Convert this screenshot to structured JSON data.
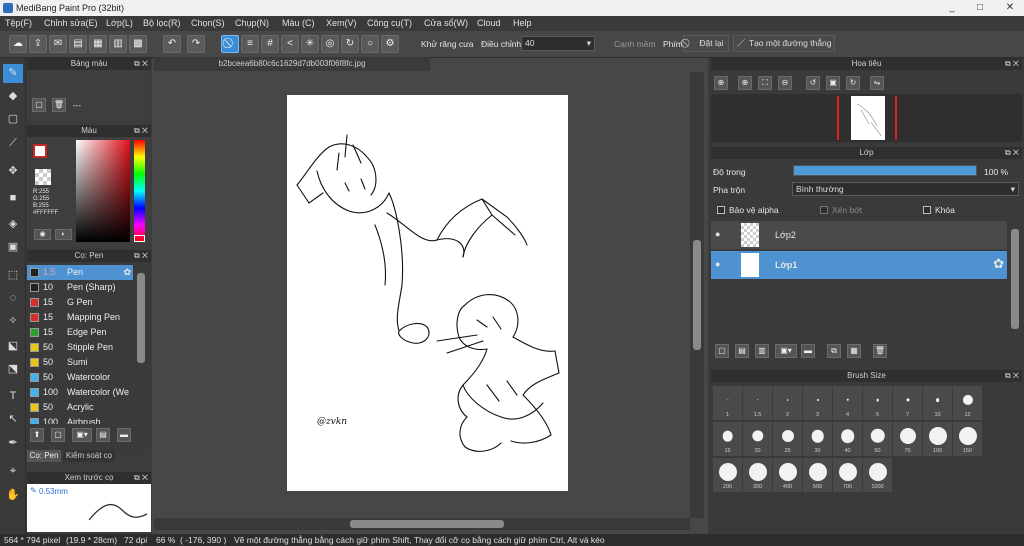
{
  "window": {
    "title": "MediBang Paint Pro (32bit)",
    "minimize": "_",
    "maximize": "□",
    "close": "✕"
  },
  "menu": [
    "Tệp(F)",
    "Chỉnh sửa(E)",
    "Lớp(L)",
    "Bộ lọc(R)",
    "Chọn(S)",
    "Chụp(N)",
    "Màu (C)",
    "Xem(V)",
    "Công cụ(T)",
    "Cửa sổ(W)",
    "Cloud",
    "Help"
  ],
  "toolbar": {
    "antialias_label": "Khử răng cưa",
    "adjust_label": "Điều chỉnh",
    "adjust_value": "40",
    "smooth_label": "Cạnh mềm",
    "key_label": "Phím",
    "reset_label": "Đặt lại",
    "straight_line_label": "Tạo một đường thẳng"
  },
  "palette_panel": {
    "title": "Bảng màu",
    "empty_label": "---"
  },
  "color_panel": {
    "title": "Màu",
    "r": "R:255",
    "g": "G:255",
    "b": "B:255",
    "hex": "#FFFFFF"
  },
  "brush_panel": {
    "title": "Cọ: Pen",
    "brushes": [
      {
        "size": "1.5",
        "name": "Pen",
        "color": "#222222"
      },
      {
        "size": "10",
        "name": "Pen (Sharp)",
        "color": "#222222"
      },
      {
        "size": "15",
        "name": "G Pen",
        "color": "#d32f2f"
      },
      {
        "size": "15",
        "name": "Mapping Pen",
        "color": "#d32f2f"
      },
      {
        "size": "15",
        "name": "Edge Pen",
        "color": "#2e9e2e"
      },
      {
        "size": "50",
        "name": "Stipple Pen",
        "color": "#e6c619"
      },
      {
        "size": "50",
        "name": "Sumi",
        "color": "#e6c619"
      },
      {
        "size": "50",
        "name": "Watercolor",
        "color": "#44b2e8"
      },
      {
        "size": "100",
        "name": "Watercolor (We",
        "color": "#44b2e8"
      },
      {
        "size": "50",
        "name": "Acrylic",
        "color": "#e6c619"
      },
      {
        "size": "100",
        "name": "Airbrush",
        "color": "#44b2e8"
      }
    ],
    "tab_pen": "Cọ: Pen",
    "tab_control": "Kiểm soát cọ"
  },
  "preview_panel": {
    "title": "Xem trước cọ",
    "size": "0.53mm"
  },
  "document": {
    "tab_name": "b2bceea6b80c6c1629d7db003f06f8fc.jpg",
    "signature": "@zvkn"
  },
  "navigator": {
    "title": "Hoa tiêu"
  },
  "layers": {
    "title": "Lớp",
    "opacity_label": "Độ trong",
    "opacity_value": "100 %",
    "opacity": 1.0,
    "blend_label": "Pha trộn",
    "blend_value": "Bình thường",
    "protect_alpha": "Bảo vệ alpha",
    "clipping": "Xén bớt",
    "lock": "Khóa",
    "items": [
      {
        "name": "Lớp2",
        "selected": false
      },
      {
        "name": "Lớp1",
        "selected": true
      }
    ]
  },
  "brush_size": {
    "title": "Brush Size",
    "sizes": [
      "1",
      "1.5",
      "2",
      "3",
      "4",
      "5",
      "7",
      "10",
      "12",
      "15",
      "20",
      "25",
      "30",
      "40",
      "50",
      "70",
      "100",
      "150",
      "200",
      "300",
      "400",
      "500",
      "700",
      "1000"
    ]
  },
  "status": {
    "dimensions": "564 * 794 pixel",
    "physical": "(19.9 * 28cm)",
    "dpi": "72 dpi",
    "zoom": "66 %",
    "coords": "( -176, 390 )",
    "hint": "Vẽ một đường thẳng bằng cách giữ phím Shift, Thay đổi cỡ cọ bằng cách giữ phím Ctrl, Alt và kéo"
  }
}
